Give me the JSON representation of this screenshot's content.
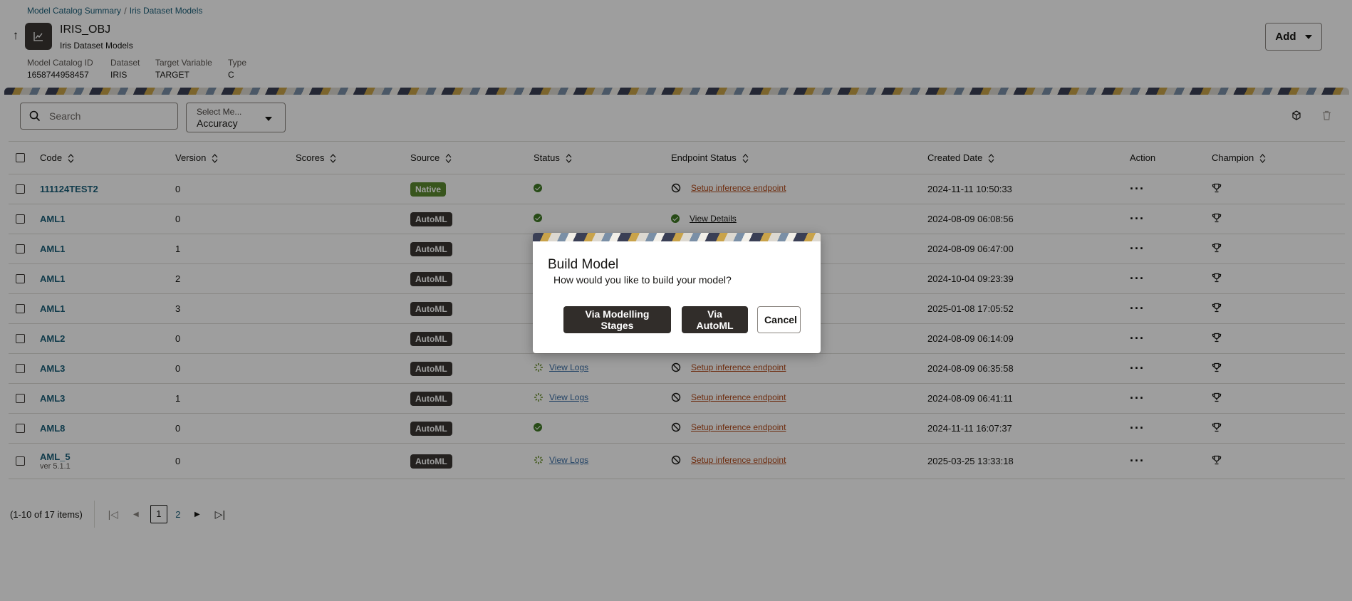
{
  "breadcrumb": {
    "items": [
      "Model Catalog Summary",
      "Iris Dataset Models"
    ],
    "separator": "/"
  },
  "header": {
    "title": "IRIS_OBJ",
    "subtitle": "Iris Dataset Models",
    "add_label": "Add"
  },
  "meta": [
    {
      "key": "Model Catalog ID",
      "value": "1658744958457"
    },
    {
      "key": "Dataset",
      "value": "IRIS"
    },
    {
      "key": "Target Variable",
      "value": "TARGET"
    },
    {
      "key": "Type",
      "value": "C"
    }
  ],
  "toolbar": {
    "search_placeholder": "Search",
    "select_label": "Select Me...",
    "select_value": "Accuracy"
  },
  "columns": [
    "Code",
    "Version",
    "Scores",
    "Source",
    "Status",
    "Endpoint Status",
    "Created Date",
    "Action",
    "Champion"
  ],
  "rows": [
    {
      "code": "111124TEST2",
      "sub": "",
      "version": "0",
      "source": "Native",
      "status_text": "",
      "endpoint_text": "Setup inference endpoint",
      "created": "2024-11-11 10:50:33"
    },
    {
      "code": "AML1",
      "sub": "",
      "version": "0",
      "source": "AutoML",
      "status_text": "",
      "endpoint_text": "View Details",
      "created": "2024-08-09 06:08:56"
    },
    {
      "code": "AML1",
      "sub": "",
      "version": "1",
      "source": "AutoML",
      "status_text": "",
      "endpoint_text": "",
      "created": "2024-08-09 06:47:00"
    },
    {
      "code": "AML1",
      "sub": "",
      "version": "2",
      "source": "AutoML",
      "status_text": "",
      "endpoint_text": "",
      "created": "2024-10-04 09:23:39"
    },
    {
      "code": "AML1",
      "sub": "",
      "version": "3",
      "source": "AutoML",
      "status_text": "",
      "endpoint_text": "",
      "created": "2025-01-08 17:05:52"
    },
    {
      "code": "AML2",
      "sub": "",
      "version": "0",
      "source": "AutoML",
      "status_text": "",
      "endpoint_text": "",
      "created": "2024-08-09 06:14:09"
    },
    {
      "code": "AML3",
      "sub": "",
      "version": "0",
      "source": "AutoML",
      "status_text": "View Logs",
      "endpoint_text": "Setup inference endpoint",
      "created": "2024-08-09 06:35:58"
    },
    {
      "code": "AML3",
      "sub": "",
      "version": "1",
      "source": "AutoML",
      "status_text": "View Logs",
      "endpoint_text": "Setup inference endpoint",
      "created": "2024-08-09 06:41:11"
    },
    {
      "code": "AML8",
      "sub": "",
      "version": "0",
      "source": "AutoML",
      "status_text": "",
      "endpoint_text": "Setup inference endpoint",
      "created": "2024-11-11 16:07:37"
    },
    {
      "code": "AML_5",
      "sub": "ver 5.1.1",
      "version": "0",
      "source": "AutoML",
      "status_text": "View Logs",
      "endpoint_text": "Setup inference endpoint",
      "created": "2025-03-25 13:33:18"
    }
  ],
  "pagination": {
    "summary": "(1-10 of 17 items)",
    "current": "1",
    "next": "2"
  },
  "dialog": {
    "title": "Build Model",
    "message": "How would you like to build your model?",
    "btn_stages": "Via Modelling Stages",
    "btn_automl": "Via AutoML",
    "btn_cancel": "Cancel"
  },
  "icons": {
    "back": "arrow-up-icon",
    "model": "chart-icon",
    "search": "search-icon",
    "export": "cube-icon",
    "delete": "trash-icon",
    "sort": "sort-icon",
    "more": "more-icon",
    "champion": "trophy-icon"
  },
  "colors": {
    "link": "#1a5f7a",
    "native": "#5b8a2f",
    "automl": "#3a3632",
    "ok": "#3f7a25",
    "setup_link": "#b24a1a",
    "dark_button": "#312d2a"
  }
}
